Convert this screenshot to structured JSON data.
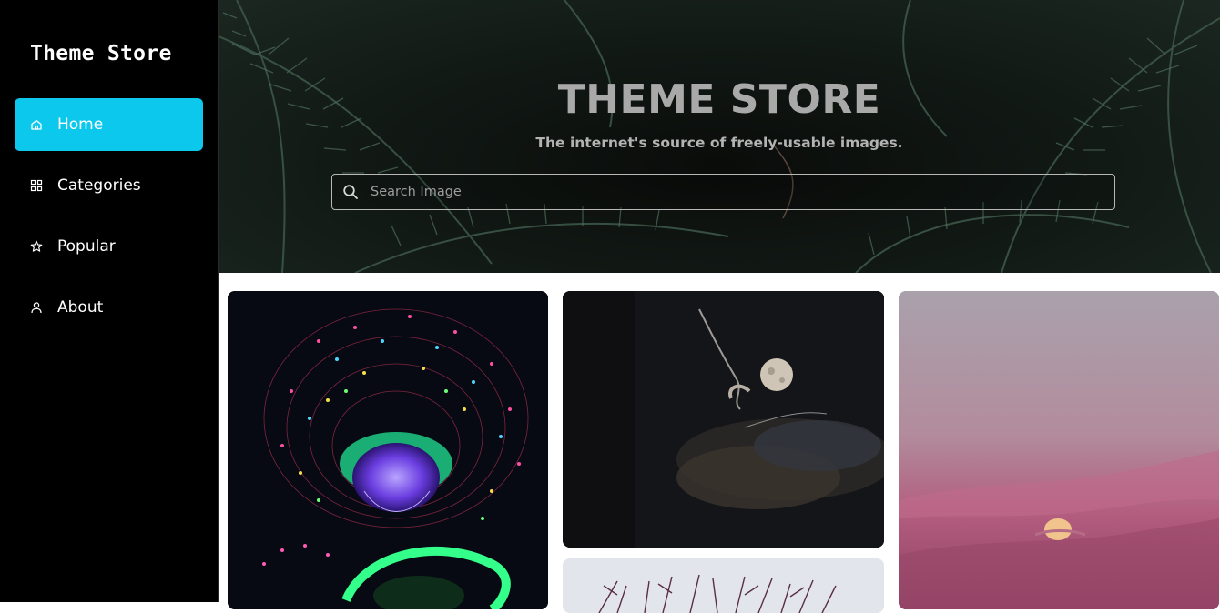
{
  "sidebar": {
    "brand": "Theme Store",
    "items": [
      {
        "label": "Home",
        "icon": "home-icon",
        "active": true
      },
      {
        "label": "Categories",
        "icon": "grid-icon",
        "active": false
      },
      {
        "label": "Popular",
        "icon": "star-icon",
        "active": false
      },
      {
        "label": "About",
        "icon": "user-icon",
        "active": false
      }
    ],
    "active_color": "#0cc8ec"
  },
  "hero": {
    "title": "THEME STORE",
    "subtitle": "The internet's source of freely-usable images.",
    "search_placeholder": "Search Image",
    "search_value": ""
  },
  "gallery": {
    "images": [
      {
        "icon": "supertree-night-lights-image"
      },
      {
        "icon": "moon-clouds-night-image"
      },
      {
        "icon": "pink-sky-moon-image"
      },
      {
        "icon": "bare-tree-branches-image"
      }
    ]
  }
}
